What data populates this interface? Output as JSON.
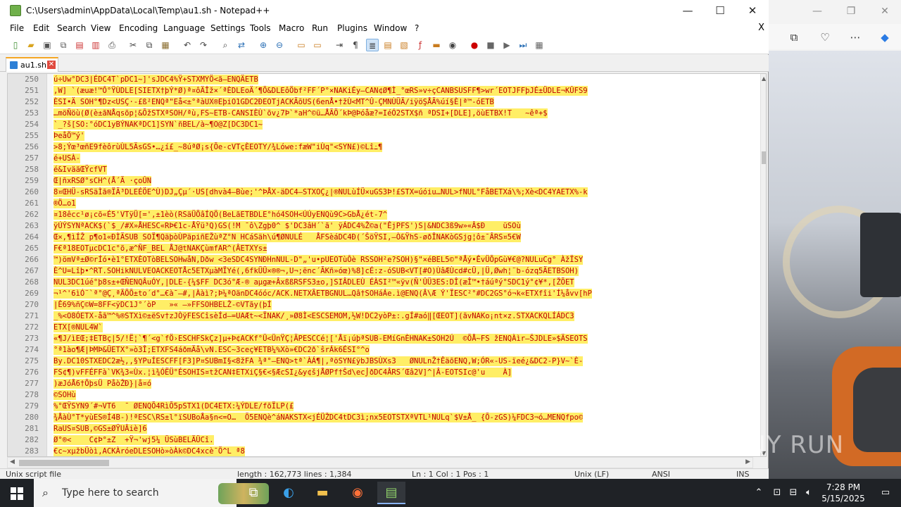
{
  "window": {
    "title": "C:\\Users\\admin\\AppData\\Local\\Temp\\au1.sh - Notepad++",
    "minimize": "—",
    "maximize": "☐",
    "close": "✕"
  },
  "menu": {
    "items": [
      "File",
      "Edit",
      "Search",
      "View",
      "Encoding",
      "Language",
      "Settings",
      "Tools",
      "Macro",
      "Run",
      "Plugins",
      "Window",
      "?"
    ],
    "close": "X"
  },
  "toolbar": {
    "icons": [
      "new-file-icon",
      "open-file-icon",
      "save-icon",
      "save-all-icon",
      "close-icon",
      "close-all-icon",
      "print-icon",
      "cut-icon",
      "copy-icon",
      "paste-icon",
      "undo-icon",
      "redo-icon",
      "find-icon",
      "replace-icon",
      "zoom-in-icon",
      "zoom-out-icon",
      "sync-v-icon",
      "sync-h-icon",
      "word-wrap-icon",
      "show-all-chars-icon",
      "indent-guide-icon",
      "udl-icon",
      "doc-map-icon",
      "function-list-icon",
      "folder-workspace-icon",
      "monitor-icon",
      "record-macro-icon",
      "stop-macro-icon",
      "play-macro-icon",
      "run-macro-multiple-icon",
      "save-macro-icon"
    ]
  },
  "tab": {
    "label": "au1.sh",
    "close": "✕"
  },
  "editor": {
    "lines": [
      {
        "num": "250",
        "text": "ú÷Uw°DC3|ÉDC4T`pDC1~]'sJDC4%Ÿ+STXMYÖ<ã–ENQÄETB"
      },
      {
        "num": "251",
        "text": ",W] `(æuæ!™Ô°ŸÙDLE[SIETX†þÝ*Ø)ª¤ôÄÎž×´ªÈDLEoÄ´¶Õ&DLEôÖbf²FF´P°×NAKiÉy—CAN¢Ø¶Ì_°œRS»v÷çCANBSUSFF¶>wr´EOTJFFþJÉ±ÜDLE¬KÛFS9"
      },
      {
        "num": "252",
        "text": "ÈSI•Ä SOH°¶Dz<USÇ·-£ß²ENQª\"Eå<±°ªàUX®EþiO1GDC2ÐEOTjACKÄõUS(6enÅ•†žÙ<MT^Û-ÇMNÙÜÄ/iÿöŞÅÃ%úí§È|ª™-óETB"
      },
      {
        "num": "253",
        "text": "…möÑöù(Ø(è±ãNÅqsõp¦&ÕžSTXªSOH/ªù,FS~ETB-CANSIÈÙ`õv¿7Þ`*aH^©ü…ÅÃÖ´kÞ@Þóåæ?=IéÓ2STX$ñ ªDSI+[DLE],öùETBX!T   ~êª+$"
      },
      {
        "num": "254",
        "text": "`_?š[SO:°óDC1yBÝNAKªDC1]SYN`ñBEL/à~¶O@Z[DC3DC1~"
      },
      {
        "num": "255",
        "text": "ÞeåÖ™ý'"
      },
      {
        "num": "256",
        "text": ">8;Ýœ³œñE9fèôrùÙL5ÄsGS•…¿í£_~8úªØ¡s{Õe-cVTçÈEOTY/¾Lówe:fæW\"iÙq\"<SYN£)©Lî߸¶"
      },
      {
        "num": "257",
        "text": "é+USÀ-"
      },
      {
        "num": "258",
        "text": "é&IvääŒŸcfVT"
      },
      {
        "num": "259",
        "text": "Œ|ñxRSØ°sCH^(Å´Ã ·çoÛN"
      },
      {
        "num": "260",
        "text": "8¤ŒHÜ-sRSäÌã®ÏÃ³DLEÉÖE^Ù)DJ„Çµ´·US[dhvà4–Bùe;'^ÞÅX-äDC4—STXOÇ¿|®NULùÍÜ×uGS3Þ!£STX=úóiu…NUL>fNUL°FåBETXá\\%;Xè<DC4YAETX%-k"
      },
      {
        "num": "261",
        "text": "®Ö…o1"
      },
      {
        "num": "262",
        "text": "¤18êcc¹ø¡cõ«É5'VTÿÜ[=',±1èò(RSäÜÕâÍQÖ(BeLãETBDLE°hó4SOH<ÚÚyENQù9C>GbÅ¿ét-7^"
      },
      {
        "num": "263",
        "text": "ÿÚÝSYNªACK$(`$_/#X»ÅHESC«RÞ€1c-ÅŸü³Q)GS(!M ¯ô\\Zgþ0^ $'DC3âH´`ã' ÿÁDC4%Ž©a(\"ÊjPFS')S|&NDC3ß9w»«Â$Ð    üSOù"
      },
      {
        "num": "264",
        "text": "Œ×,¶ìÍŽ p¶o1«ÐÌÄSUB SOÏ¶QäþòÙPäpiñEŽùªZ°N HCáSäh\\ú¶ØNULÉ   ÅFSèáDC4Ð(´ŠöŸSI,—Ò&ŸhS-øðÎNAKòGSjg¦ô±¯ÂRS¤5€W"
      },
      {
        "num": "265",
        "text": "F€ª18EOTµcDC1c°õ,æ^ÑF_BEL ÅJ@tNAKÇùmfAR^(ÂETXYs±"
      },
      {
        "num": "266",
        "text": "™)ömVª±Ø©rÍó•è1°ETXÈOTòBELSOHwåN,Dðw <3eSDC4SYNÐHnNUL-D\"„'u•pUEOTùÔè RSSOH²e?SOH)§\"×éBEL5©\"ªÅý•ÊvÜÕpGù¥€@?NULuCg° ÀžÏSY"
      },
      {
        "num": "267",
        "text": "È^U=Lîþ•^RT.SOHikNULVEOACKEOTÅc5ETXµàMÏYé(,6fkÜÜ×®®¬,U¬;ënc´ÃKñ»óœ)%8]cÉ:z-óSUB<VT[#O)ÙâÆÙcd#cÜ,|Ü,Øwh¦¨b-ózq5ÄETBSOH)"
      },
      {
        "num": "268",
        "text": "NUL3DC1úé°þ8s±+ŒÑENQÂuÓY,|DLE-{¼$FF DC3ó°Æ-® aµgæ+ÂxßßRSFS3±o,]SIÂDLEÙ ÉÀSI²™«ÿv(Ñ'ÛÜ3ES:DÎ(æÎ™•†áúªý°SDC1ý°¢¥*,[ŽÕET"
      },
      {
        "num": "269",
        "text": "¬¹^'6ìÓ¨`ª°@Ç͵ªÃÕÕ±to´d°…€à¯—#,|Ààì?;Þ¼ªOänDC4óóc/ACK.NETXÃETBGNUL…Qâ†SOHáÁe.ì@ENQ(Â\\Æ Ý'ÏESC²°#DC2GS°ó¬k«ETXfîi'Í¼åvv[hP"
      },
      {
        "num": "270",
        "text": "|Ê69%ñÇ©W=8FF<ÿDC1J°´òP   »« —»FFSOHBELŽ-©VTãy(þÍ"
      },
      {
        "num": "271",
        "text": "_%<O8ÓETX-åã™^%®STXì©±ëSv†zJÒÿFESCîsèÍd—=UAÆt~<ÏNAK/¸»Ø8Ì<ESCSEMOM,½W!DC2yòP±:.gÍ#aó‖[ŒEOT](ãvNAKo¡nt×z.STXACKQLÍÁDC3"
      },
      {
        "num": "272",
        "text": "ETX[®NUL4W`"
      },
      {
        "num": "273",
        "text": "«¶J/ìEŒ;‡ETBç|5/!Ë¦`¶´<g`fÖ›ESCHFSkÇz]µ+Þ¢ACKf°Ü<ÜnŸÇ¦ÄPESCCé¦['Åï¡úþªSUB-EMíGnÈHNAK±SOH2Ú  ©ÕÅ~FS žENQÀìr—ŠJDLE»$ÄSEOTS"
      },
      {
        "num": "274",
        "text": "°ª1ào¶Æ|ÞMÞ&ÜETX°»ò3Î;ETXFS4áðmÄå\\vN.ESC~3ceç¥ETB¼%Xò»€DC2ð`ŝrÁk6ÉSI°^o"
      },
      {
        "num": "275",
        "text": "By.DC10STXEDC2æ½,,§YPuÍESCFF[F3]P¤SUBmI§<8žFA ¾ª°—ENQ>tª`ÀÁ¶|,ªöSYN£ÿbJBSÙXs3   ØNULnŽ†ÊäõENQ,W;ÓR«-US-ïeé¿&DC2-P}V~`È-"
      },
      {
        "num": "276",
        "text": "FS¢¶)vFFÉFFà`VK¾3«Ùx.¦ì¾ÓËÜ°ÉSOHIS¤tžCAN‡ETXiÇ§€<§ÆcSI¿&y¢šjÅØPf†Šd\\ec⌡ðDC4ÂRS´Œâ2V]^|Â-EOTSIc@'u    À]"
      },
      {
        "num": "277",
        "text": ")æJóÅ6†ÕþsÜ PåòŽÐ}|å¤ó"
      },
      {
        "num": "278",
        "text": "©SOHù"
      },
      {
        "num": "279",
        "text": "%°ŒŸSYN9´#¬VT6  ¯ ØENQÕ4RìÕ5pSTX1(DC4ETX:¼ÝDLE/fõÏLP(£"
      },
      {
        "num": "280",
        "text": "¾ÅàÙ°T*yùES®Í4B-)!ªESC\\RS±l°ïSUBoÅa§n<=O…  Õ5ENQè^áNAKSTX<jÉÜŽDC4tDC3ì;nx5EOTSTXªVTL¹NULq`$V±Å_ {Õ-zGS)¼FDC3¬ó…MENQfpo©"
      },
      {
        "num": "281",
        "text": "RaUS¤SUB,©GS±ØŸUÂiè]6"
      },
      {
        "num": "282",
        "text": "Ø°®<    C¢Þ°±Z  +Ÿ¬'wj5¼ ÜSùBELÄÜCî."
      },
      {
        "num": "283",
        "text": "€c~xµžbÜòì,ACKÀróeDLESOHò»òÀk©DC4xcè¯Ö^L ª8"
      }
    ]
  },
  "status": {
    "file_type": "Unix script file",
    "length": "length : 162,773   lines : 1,384",
    "position": "Ln : 1   Col : 1   Pos : 1",
    "eol": "Unix (LF)",
    "encoding": "ANSI",
    "mode": "INS"
  },
  "taskbar": {
    "search_placeholder": "Type here to search",
    "time": "7:28 PM",
    "date": "5/15/2025"
  },
  "watermark": "ANY RUN"
}
